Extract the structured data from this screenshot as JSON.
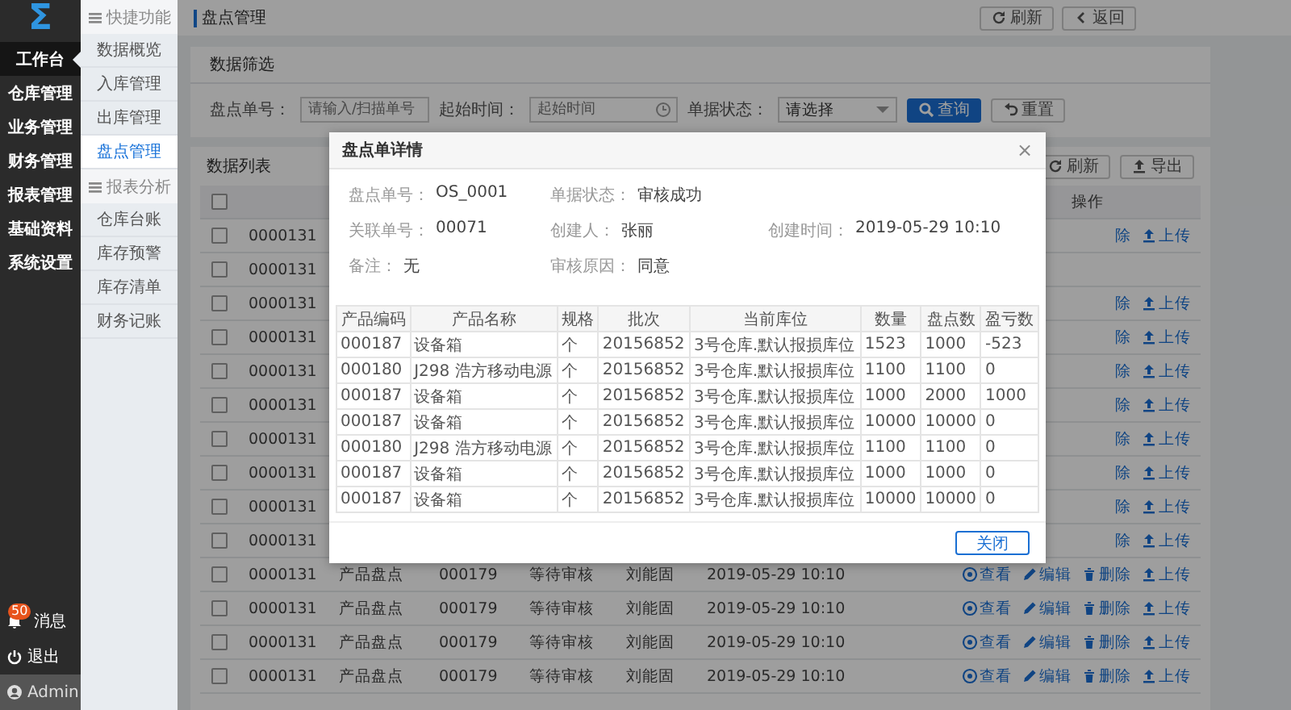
{
  "nav": {
    "logo": "Σ",
    "items": [
      {
        "label": "工作台",
        "selected": true
      },
      {
        "label": "仓库管理",
        "selected": false
      },
      {
        "label": "业务管理",
        "selected": false
      },
      {
        "label": "财务管理",
        "selected": false
      },
      {
        "label": "报表管理",
        "selected": false
      },
      {
        "label": "基础资料",
        "selected": false
      },
      {
        "label": "系统设置",
        "selected": false
      }
    ],
    "footer": {
      "messages": {
        "label": "消息",
        "badge": "50"
      },
      "logout": {
        "label": "退出"
      },
      "user": {
        "label": "Admin"
      }
    }
  },
  "subnav": {
    "sections": [
      {
        "title": "快捷功能",
        "items": [
          {
            "label": "数据概览",
            "selected": false
          },
          {
            "label": "入库管理",
            "selected": false
          },
          {
            "label": "出库管理",
            "selected": false
          },
          {
            "label": "盘点管理",
            "selected": true
          }
        ]
      },
      {
        "title": "报表分析",
        "items": [
          {
            "label": "仓库台账",
            "selected": false
          },
          {
            "label": "库存预警",
            "selected": false
          },
          {
            "label": "库存清单",
            "selected": false
          },
          {
            "label": "财务记账",
            "selected": false
          }
        ]
      }
    ]
  },
  "page": {
    "title": "盘点管理",
    "buttons": [
      {
        "kind": "refresh",
        "label": "刷新"
      },
      {
        "kind": "back",
        "label": "返回"
      }
    ]
  },
  "filter": {
    "title": "数据筛选",
    "fields": [
      {
        "kind": "text",
        "label": "盘点单号：",
        "placeholder": "请输入/扫描单号"
      },
      {
        "kind": "date",
        "label": "起始时间：",
        "placeholder": "起始时间"
      },
      {
        "kind": "select",
        "label": "单据状态：",
        "value": "请选择"
      }
    ],
    "buttons": [
      {
        "kind": "search",
        "label": "查询",
        "primary": true
      },
      {
        "kind": "reset",
        "label": "重置",
        "primary": false
      }
    ]
  },
  "list": {
    "title": "数据列表",
    "buttons": [
      {
        "kind": "refresh",
        "label": "刷新"
      },
      {
        "kind": "export",
        "label": "导出"
      }
    ],
    "table": {
      "header": {
        "checked": false,
        "actions": "操作"
      },
      "rows": [
        {
          "kind": "covered",
          "checked": false,
          "code": "0000131",
          "ops": [
            {
              "kind": "delete",
              "label": "除",
              "icon": false
            },
            {
              "kind": "upload",
              "label": "上传",
              "icon": true
            }
          ]
        },
        {
          "kind": "covered",
          "checked": false,
          "code": "0000131"
        },
        {
          "kind": "covered",
          "checked": false,
          "code": "0000131",
          "ops": [
            {
              "kind": "delete",
              "label": "除",
              "icon": false
            },
            {
              "kind": "upload",
              "label": "上传",
              "icon": true
            }
          ]
        },
        {
          "kind": "covered",
          "checked": false,
          "code": "0000131",
          "ops": [
            {
              "kind": "delete",
              "label": "除",
              "icon": false
            },
            {
              "kind": "upload",
              "label": "上传",
              "icon": true
            }
          ]
        },
        {
          "kind": "covered",
          "checked": false,
          "code": "0000131",
          "ops": [
            {
              "kind": "delete",
              "label": "除",
              "icon": false
            },
            {
              "kind": "upload",
              "label": "上传",
              "icon": true
            }
          ]
        },
        {
          "kind": "covered",
          "checked": false,
          "code": "0000131",
          "ops": [
            {
              "kind": "delete",
              "label": "除",
              "icon": false
            },
            {
              "kind": "upload",
              "label": "上传",
              "icon": true
            }
          ]
        },
        {
          "kind": "covered",
          "checked": false,
          "code": "0000131",
          "ops": [
            {
              "kind": "delete",
              "label": "除",
              "icon": false
            },
            {
              "kind": "upload",
              "label": "上传",
              "icon": true
            }
          ]
        },
        {
          "kind": "covered",
          "checked": false,
          "code": "0000131",
          "ops": [
            {
              "kind": "delete",
              "label": "除",
              "icon": false
            },
            {
              "kind": "upload",
              "label": "上传",
              "icon": true
            }
          ]
        },
        {
          "kind": "covered",
          "checked": false,
          "code": "0000131",
          "ops": [
            {
              "kind": "delete",
              "label": "除",
              "icon": false
            },
            {
              "kind": "upload",
              "label": "上传",
              "icon": true
            }
          ]
        },
        {
          "kind": "covered",
          "checked": false,
          "code": "0000131",
          "ops": [
            {
              "kind": "delete",
              "label": "除",
              "icon": false
            },
            {
              "kind": "upload",
              "label": "上传",
              "icon": true
            }
          ]
        },
        {
          "kind": "full",
          "checked": false,
          "cells": [
            "0000131",
            "产品盘点",
            "000179",
            "等待审核",
            "刘能固",
            "2019-05-29 10:10"
          ],
          "ops": [
            {
              "kind": "view",
              "label": "查看",
              "icon": true
            },
            {
              "kind": "edit",
              "label": "编辑",
              "icon": true
            },
            {
              "kind": "delete",
              "label": "删除",
              "icon": true
            },
            {
              "kind": "upload",
              "label": "上传",
              "icon": true
            }
          ]
        },
        {
          "kind": "full",
          "checked": false,
          "cells": [
            "0000131",
            "产品盘点",
            "000179",
            "等待审核",
            "刘能固",
            "2019-05-29 10:10"
          ],
          "ops": [
            {
              "kind": "view",
              "label": "查看",
              "icon": true
            },
            {
              "kind": "edit",
              "label": "编辑",
              "icon": true
            },
            {
              "kind": "delete",
              "label": "删除",
              "icon": true
            },
            {
              "kind": "upload",
              "label": "上传",
              "icon": true
            }
          ]
        },
        {
          "kind": "full",
          "checked": false,
          "cells": [
            "0000131",
            "产品盘点",
            "000179",
            "等待审核",
            "刘能固",
            "2019-05-29 10:10"
          ],
          "ops": [
            {
              "kind": "view",
              "label": "查看",
              "icon": true
            },
            {
              "kind": "edit",
              "label": "编辑",
              "icon": true
            },
            {
              "kind": "delete",
              "label": "删除",
              "icon": true
            },
            {
              "kind": "upload",
              "label": "上传",
              "icon": true
            }
          ]
        },
        {
          "kind": "full",
          "checked": false,
          "cells": [
            "0000131",
            "产品盘点",
            "000179",
            "等待审核",
            "刘能固",
            "2019-05-29 10:10"
          ],
          "ops": [
            {
              "kind": "view",
              "label": "查看",
              "icon": true
            },
            {
              "kind": "edit",
              "label": "编辑",
              "icon": true
            },
            {
              "kind": "delete",
              "label": "删除",
              "icon": true
            },
            {
              "kind": "upload",
              "label": "上传",
              "icon": true
            }
          ]
        }
      ]
    }
  },
  "dialog": {
    "title": "盘点单详情",
    "close": "×",
    "info": [
      [
        {
          "label": "盘点单号：",
          "value": "OS_0001"
        },
        {
          "label": "单据状态：",
          "value": "审核成功"
        }
      ],
      [
        {
          "label": "关联单号：",
          "value": "00071"
        },
        {
          "label": "创建人：",
          "value": "张丽"
        },
        {
          "label": "创建时间：",
          "value": "2019-05-29 10:10"
        }
      ],
      [
        {
          "label": "备注：",
          "value": "无"
        },
        {
          "label": "审核原因：",
          "value": "同意"
        }
      ]
    ],
    "table": {
      "columns": [
        "产品编码",
        "产品名称",
        "规格",
        "批次",
        "当前库位",
        "数量",
        "盘点数",
        "盈亏数"
      ],
      "rows": [
        [
          "000187",
          "设备箱",
          "个",
          "20156852",
          "3号仓库.默认报损库位",
          "1523",
          "1000",
          "-523"
        ],
        [
          "000180",
          "J298 浩方移动电源",
          "个",
          "20156852",
          "3号仓库.默认报损库位",
          "1100",
          "1100",
          "0"
        ],
        [
          "000187",
          "设备箱",
          "个",
          "20156852",
          "3号仓库.默认报损库位",
          "1000",
          "2000",
          "1000"
        ],
        [
          "000187",
          "设备箱",
          "个",
          "20156852",
          "3号仓库.默认报损库位",
          "10000",
          "10000",
          "0"
        ],
        [
          "000180",
          "J298 浩方移动电源",
          "个",
          "20156852",
          "3号仓库.默认报损库位",
          "1100",
          "1100",
          "0"
        ],
        [
          "000187",
          "设备箱",
          "个",
          "20156852",
          "3号仓库.默认报损库位",
          "1000",
          "1000",
          "0"
        ],
        [
          "000187",
          "设备箱",
          "个",
          "20156852",
          "3号仓库.默认报损库位",
          "10000",
          "10000",
          "0"
        ]
      ]
    },
    "buttons": [
      {
        "label": "关闭"
      }
    ]
  }
}
